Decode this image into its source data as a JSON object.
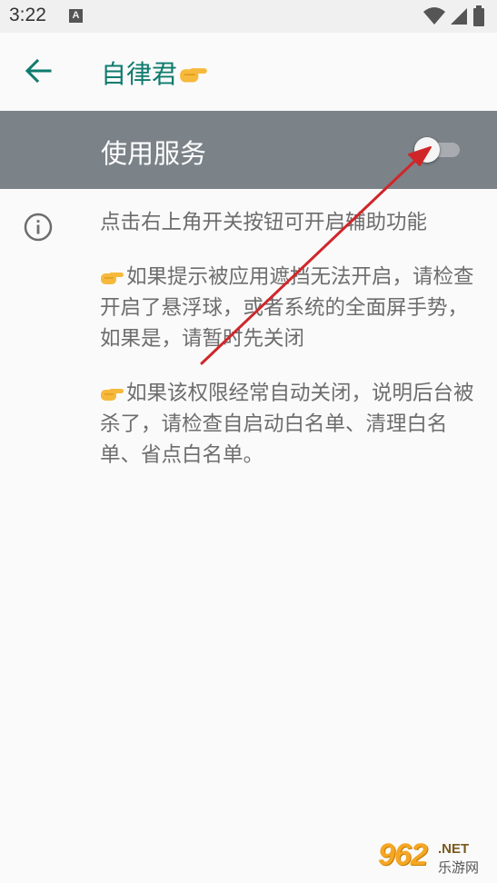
{
  "status_bar": {
    "time": "3:22",
    "notification_letter": "A"
  },
  "app_bar": {
    "title": "自律君",
    "title_emoji": "pointing-hand"
  },
  "service": {
    "label": "使用服务",
    "enabled": false
  },
  "info": {
    "paragraphs": [
      {
        "hand": false,
        "text": "点击右上角开关按钮可开启辅助功能"
      },
      {
        "hand": true,
        "text": "如果提示被应用遮挡无法开启，请检查开启了悬浮球，或者系统的全面屏手势，如果是，请暂时先关闭"
      },
      {
        "hand": true,
        "text": "如果该权限经常自动关闭，说明后台被杀了，请检查自启动白名单、清理白名单、省点白名单。"
      }
    ]
  },
  "watermark": {
    "number": "962",
    "suffix": ".NET",
    "chinese": "乐游网"
  },
  "colors": {
    "accent": "#0f7b6e",
    "service_bar": "#7b8288",
    "body_text": "#6d6d6d",
    "annotation_arrow": "#d0262a"
  }
}
